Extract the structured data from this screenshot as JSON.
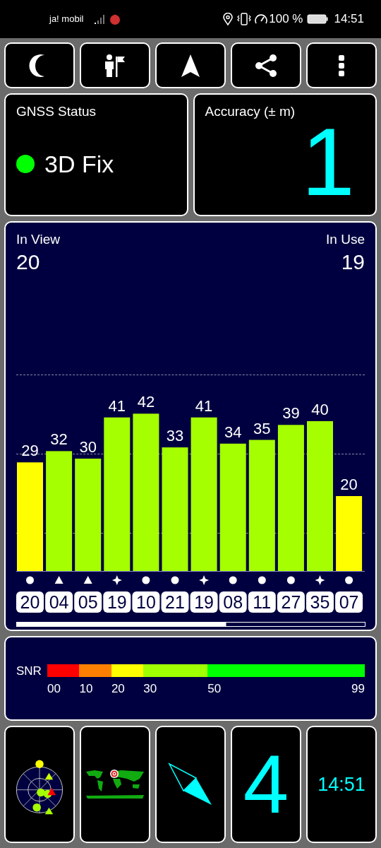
{
  "status_bar": {
    "carrier": "ja! mobil",
    "battery": "100 %",
    "time": "14:51"
  },
  "toolbar": [
    {
      "kind": "moon"
    },
    {
      "kind": "person-flag"
    },
    {
      "kind": "arrow"
    },
    {
      "kind": "share"
    },
    {
      "kind": "more"
    }
  ],
  "gnss_status": {
    "title": "GNSS Status",
    "fix": "3D Fix",
    "color": "#00ff00"
  },
  "accuracy": {
    "title": "Accuracy (± m)",
    "value": "1"
  },
  "satellites": {
    "in_view_label": "In View",
    "in_view": "20",
    "in_use_label": "In Use",
    "in_use": "19",
    "markers": [
      {
        "kind": "circle"
      },
      {
        "kind": "triangle"
      },
      {
        "kind": "triangle"
      },
      {
        "kind": "star"
      },
      {
        "kind": "circle"
      },
      {
        "kind": "circle"
      },
      {
        "kind": "star"
      },
      {
        "kind": "circle"
      },
      {
        "kind": "circle"
      },
      {
        "kind": "circle"
      },
      {
        "kind": "star"
      },
      {
        "kind": "circle"
      }
    ],
    "chart_data": {
      "type": "bar",
      "categories": [
        "20",
        "04",
        "05",
        "19",
        "10",
        "21",
        "19",
        "08",
        "11",
        "27",
        "35",
        "07"
      ],
      "series": [
        {
          "values": [
            29,
            32,
            30,
            41,
            42,
            33,
            41,
            34,
            35,
            39,
            40,
            20
          ]
        }
      ],
      "data_labels": true
    }
  },
  "snr_scale": {
    "label": "SNR",
    "stops": [
      {
        "label": "00",
        "color": "#ff0000"
      },
      {
        "label": "10",
        "color": "#ff8000"
      },
      {
        "label": "20",
        "color": "#ffff00"
      },
      {
        "label": "30",
        "color": "#a0ff00"
      },
      {
        "label": "50",
        "color": "#00ff00"
      },
      {
        "label": "99"
      }
    ]
  },
  "tiles": [
    {
      "kind": "radar"
    },
    {
      "kind": "map"
    },
    {
      "kind": "compass"
    },
    {
      "kind": "value",
      "text": "4"
    },
    {
      "kind": "clock",
      "text": "14:51"
    }
  ]
}
